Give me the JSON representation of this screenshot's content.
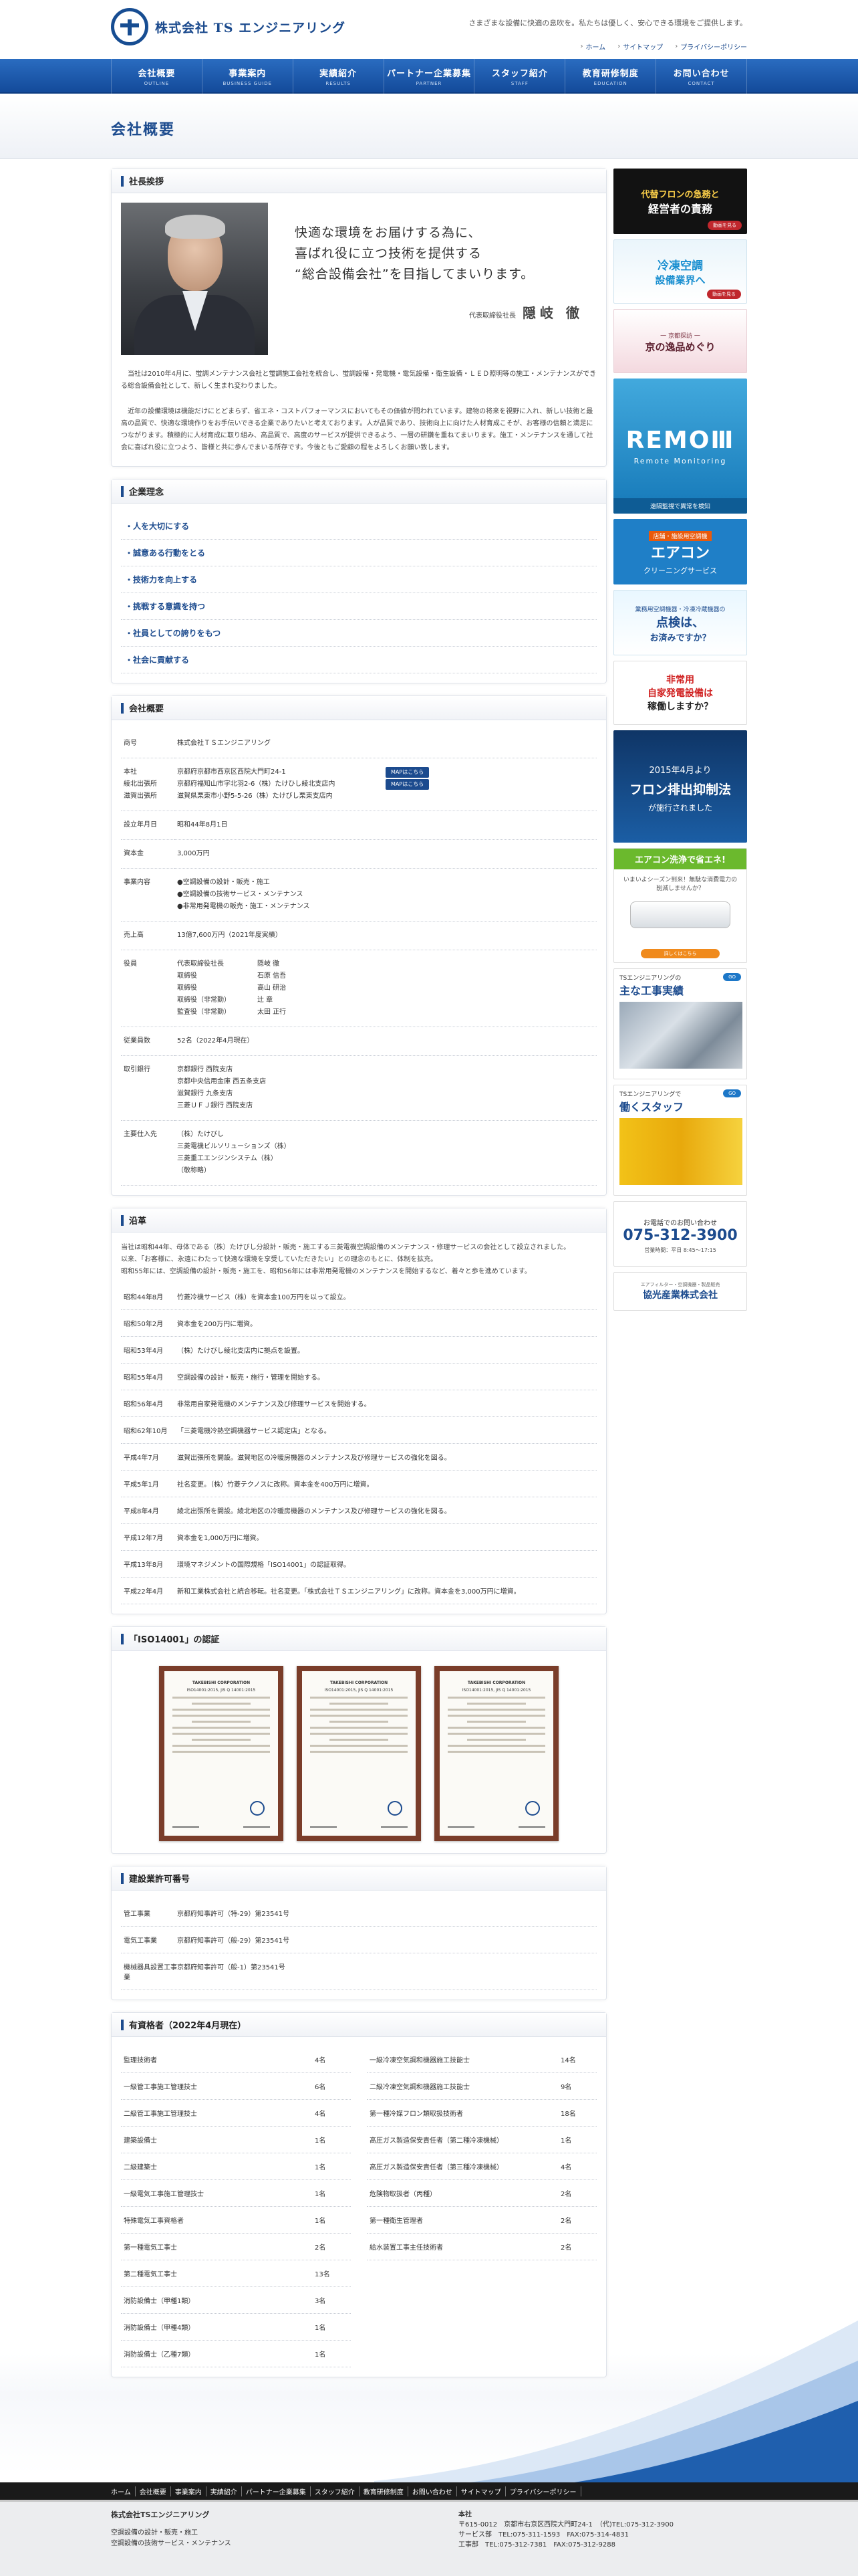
{
  "header": {
    "company": "株式会社 TS エンジニアリング",
    "tagline": "さまざまな設備に快適の息吹を。私たちは優しく、安心できる環境をご提供します。",
    "util": [
      "ホーム",
      "サイトマップ",
      "プライバシーポリシー"
    ]
  },
  "nav": [
    {
      "ja": "会社概要",
      "en": "OUTLINE"
    },
    {
      "ja": "事業案内",
      "en": "BUSINESS GUIDE"
    },
    {
      "ja": "実績紹介",
      "en": "RESULTS"
    },
    {
      "ja": "パートナー企業募集",
      "en": "PARTNER"
    },
    {
      "ja": "スタッフ紹介",
      "en": "STAFF"
    },
    {
      "ja": "教育研修制度",
      "en": "EDUCATION"
    },
    {
      "ja": "お問い合わせ",
      "en": "CONTACT"
    }
  ],
  "page_title": "会社概要",
  "greeting": {
    "heading": "社長挨拶",
    "catch1": "快適な環境をお届けする為に、",
    "catch2": "喜ばれ役に立つ技術を提供する",
    "catch3": "“総合設備会社”を目指してまいります。",
    "sign_role": "代表取締役社長",
    "sign_name": "隠岐 徹",
    "p1": "当社は2010年4月に、蛍調メンテナンス会社と蛍調施工会社を統合し、蛍調設備・発電機・電気設備・衛生設備・ＬＥＤ照明等の施工・メンテナンスができる総合設備会社として、新しく生まれ変わりました。",
    "p2": "近年の設備環境は機能だけにとどまらず、省エネ・コストパフォーマンスにおいてもその価値が問われています。建物の将来を視野に入れ、新しい技術と最高の品質で、快適な環境作りをお手伝いできる企業でありたいと考えております。人が品質であり、技術向上に向けた人材育成こそが、お客様の信頼と満足につながります。積極的に人材育成に取り組み、高品質で、高度のサービスが提供できるよう、一層の研鑽を重ねてまいります。施工・メンテナンスを通して社会に喜ばれ役に立つよう、皆様と共に歩んでまいる所存です。今後ともご愛顧の程をよろしくお願い致します。"
  },
  "philosophy": {
    "heading": "企業理念",
    "items": [
      "人を大切にする",
      "誠意ある行動をとる",
      "技術力を向上する",
      "挑戦する意識を持つ",
      "社員としての誇りをもつ",
      "社会に貢献する"
    ]
  },
  "overview": {
    "heading": "会社概要",
    "name_k": "商号",
    "name_v": "株式会社ＴＳエンジニアリング",
    "hq_k": "本社",
    "hq_v": "京都府京都市西京区西院大門町24-1",
    "north_k": "綾北出張所",
    "north_v": "京都府福知山市字北羽2-6（株）たけひし綾北支店内",
    "shiga_k": "滋賀出張所",
    "shiga_v": "滋賀県栗東市小野5-5-26（株）たけびし栗東支店内",
    "map": "MAPはこちら",
    "est_k": "設立年月日",
    "est_v": "昭和44年8月1日",
    "cap_k": "資本金",
    "cap_v": "3,000万円",
    "biz_k": "事業内容",
    "biz_v": [
      "●空調設備の設計・販売・施工",
      "●空調設備の技術サービス・メンテナンス",
      "●非常用発電機の販売・施工・メンテナンス"
    ],
    "sales_k": "売上高",
    "sales_v": "13億7,600万円（2021年度実績）",
    "off_k": "役員",
    "officers": [
      [
        "代表取締役社長",
        "隠岐 徹"
      ],
      [
        "取締役",
        "石原 信吾"
      ],
      [
        "取締役",
        "高山 研治"
      ],
      [
        "取締役（非常勤）",
        "辻 章"
      ],
      [
        "監査役（非常勤）",
        "太田 正行"
      ]
    ],
    "emp_k": "従業員数",
    "emp_v": "52名（2022年4月現在）",
    "bank_k": "取引銀行",
    "bank_v": [
      "京都銀行 西院支店",
      "京都中央信用金庫 西五条支店",
      "滋賀銀行 九条支店",
      "三菱ＵＦＪ銀行 西院支店"
    ],
    "sup_k": "主要仕入先",
    "sup_v": [
      "（株）たけびし",
      "三菱電機ビルソリューションズ（株）",
      "三菱重工エンジンシステム（株）",
      "（敬称略）"
    ]
  },
  "history": {
    "heading": "沿革",
    "intro": [
      "当社は昭和44年、母体である（株）たけびし分設計・販売・施工する三菱電機空調設備のメンテナンス・修理サービスの会社として設立されました。",
      "以来、「お客様に、永遠にわたって快適な環境を享受していただきたい」との理念のもとに、体制を拡充。",
      "昭和55年には、空調設備の設計・販売・施工を、昭和56年には非常用発電機のメンテナンスを開始するなど、着々と歩を進めています。"
    ],
    "rows": [
      [
        "昭和44年8月",
        "竹菱冷機サービス（株）を資本金100万円を以って設立。"
      ],
      [
        "昭和50年2月",
        "資本金を200万円に増資。"
      ],
      [
        "昭和53年4月",
        "（株）たけびし綾北支店内に拠点を設置。"
      ],
      [
        "昭和55年4月",
        "空調設備の設計・販売・施行・管理を開始する。"
      ],
      [
        "昭和56年4月",
        "非常用自家発電機のメンテナンス及び修理サービスを開始する。"
      ],
      [
        "昭和62年10月",
        "「三菱電機冷熱空調機器サービス認定店」となる。"
      ],
      [
        "平成4年7月",
        "滋賀出張所を開設。滋賀地区の冷暖房機器のメンテナンス及び修理サービスの強化を図る。"
      ],
      [
        "平成5年1月",
        "社名変更。（株）竹菱テクノスに改称。資本金を400万円に増資。"
      ],
      [
        "平成8年4月",
        "綾北出張所を開設。綾北地区の冷暖房機器のメンテナンス及び修理サービスの強化を図る。"
      ],
      [
        "平成12年7月",
        "資本金を1,000万円に増資。"
      ],
      [
        "平成13年8月",
        "環境マネジメントの国際規格「ISO14001」の認証取得。"
      ],
      [
        "平成22年4月",
        "新和工業株式会社と統合移転。社名変更。「株式会社ＴＳエンジニアリング」に改称。資本金を3,000万円に増資。"
      ]
    ]
  },
  "iso": {
    "heading": "「ISO14001」の認証",
    "certs": [
      {
        "company": "TAKEBISHI CORPORATION",
        "std": "ISO14001:2015, JIS Q 14001:2015"
      },
      {
        "company": "TAKEBISHI CORPORATION",
        "std": "ISO14001:2015, JIS Q 14001:2015"
      },
      {
        "company": "TAKEBISHI CORPORATION",
        "std": "ISO14001:2015, JIS Q 14001:2015"
      }
    ]
  },
  "license": {
    "heading": "建設業許可番号",
    "rows": [
      [
        "管工事業",
        "京都府知事許可（特-29）第23541号"
      ],
      [
        "電気工事業",
        "京都府知事許可（般-29）第23541号"
      ],
      [
        "機械器具設置工事業",
        "京都府知事許可（般-1）第23541号"
      ]
    ]
  },
  "qualified": {
    "heading": "有資格者（2022年4月現在）",
    "left": [
      [
        "監理技術者",
        "4名"
      ],
      [
        "一級管工事施工管理技士",
        "6名"
      ],
      [
        "二級管工事施工管理技士",
        "4名"
      ],
      [
        "建築設備士",
        "1名"
      ],
      [
        "二級建築士",
        "1名"
      ],
      [
        "一級電気工事施工管理技士",
        "1名"
      ],
      [
        "特殊電気工事資格者",
        "1名"
      ],
      [
        "第一種電気工事士",
        "2名"
      ],
      [
        "第二種電気工事士",
        "13名"
      ],
      [
        "消防設備士（甲種1類）",
        "3名"
      ],
      [
        "消防設備士（甲種4類）",
        "1名"
      ],
      [
        "消防設備士（乙種7類）",
        "1名"
      ]
    ],
    "right": [
      [
        "一級冷凍空気調和機器施工技能士",
        "14名"
      ],
      [
        "二級冷凍空気調和機器施工技能士",
        "9名"
      ],
      [
        "第一種冷媒フロン類取扱技術者",
        "18名"
      ],
      [
        "高圧ガス製造保安責任者（第二種冷凍機械）",
        "1名"
      ],
      [
        "高圧ガス製造保安責任者（第三種冷凍機械）",
        "4名"
      ],
      [
        "危険物取扱者（丙種）",
        "2名"
      ],
      [
        "第一種衛生管理者",
        "2名"
      ],
      [
        "給水装置工事主任技術者",
        "2名"
      ]
    ]
  },
  "sidebar": {
    "b1a": "代替フロンの急務と",
    "b1b": "経営者の責務",
    "b1btn": "動画を見る",
    "b2a": "冷凍空調",
    "b2b": "設備業界へ",
    "b2btn": "動画を見る",
    "b3a": "京の逸品めぐり",
    "b3b": "一 京都探訪 一",
    "b4a": "REMOⅢ",
    "b4b": "Remote Monitoring",
    "b4c": "遠隔監視で異常を検知",
    "b5a": "エアコン",
    "b5b": "クリーニングサービス",
    "b5c": "店舗・施設用空調機",
    "b6a": "点検は、",
    "b6b": "お済みですか？",
    "b6c": "業務用空調機器・冷凍冷蔵機器の",
    "b7a": "非常用",
    "b7b": "自家発電設備は",
    "b7c": "稼働しますか？",
    "b8a": "2015年4月より",
    "b8b": "フロン排出抑制法",
    "b8c": "が施行されました",
    "b9a": "エアコン洗浄で省エネ!",
    "b9b": "いまいよシーズン到来！無駄な消費電力の削減しませんか？",
    "b9btn": "詳しくはこちら",
    "b10a": "TSエンジニアリングの",
    "b10b": "主な工事実績",
    "b10btn": "GO",
    "b11a": "TSエンジニアリングで",
    "b11b": "働くスタッフ",
    "b11btn": "GO",
    "b12a": "お電話でのお問い合わせ",
    "b12b": "075-312-3900",
    "b12c": "営業時間：平日 8:45〜17:15",
    "b13a": "協光産業株式会社",
    "b13b": "エアフィルター・空調機器・製品販売"
  },
  "footer": {
    "nav": [
      "ホーム",
      "会社概要",
      "事業案内",
      "実績紹介",
      "パートナー企業募集",
      "スタッフ紹介",
      "教育研修制度",
      "お問い合わせ",
      "サイトマップ",
      "プライバシーポリシー"
    ],
    "name": "株式会社TSエンジニアリング",
    "l1": "空調設備の設計・販売・施工",
    "l2": "空調設備の技術サービス・メンテナンス",
    "r_title": "本社",
    "r1": "〒615-0012　京都市右京区西院大門町24-1　（代)TEL:075-312-3900",
    "r2": "サービス部　TEL:075-311-1593　FAX:075-314-4831",
    "r3": "工事部　TEL:075-312-7381　FAX:075-312-9288"
  }
}
